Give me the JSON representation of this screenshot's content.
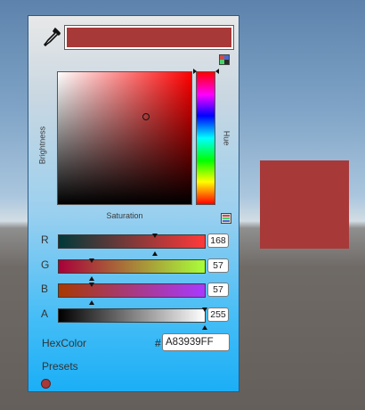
{
  "colors": {
    "current": "#A83939",
    "hue_pure": "#FF0000",
    "red_track_from": "#003939",
    "red_track_to": "#FF3939",
    "green_track_from": "#A80039",
    "green_track_to": "#A8FF39",
    "blue_track_from": "#A83900",
    "blue_track_to": "#A839FF",
    "alpha_track_from": "#000000",
    "alpha_track_to": "#FFFFFF"
  },
  "picker": {
    "brightness_label": "Brightness",
    "saturation_label": "Saturation",
    "hue_label": "Hue",
    "saturation": 0.66,
    "brightness": 0.66,
    "hue": 0.0
  },
  "channels": [
    {
      "label": "R",
      "value": "168"
    },
    {
      "label": "G",
      "value": "57"
    },
    {
      "label": "B",
      "value": "57"
    },
    {
      "label": "A",
      "value": "255"
    }
  ],
  "hex": {
    "label": "HexColor",
    "hash": "#",
    "value": "A83939FF"
  },
  "presets": {
    "label": "Presets",
    "items": [
      "#A83939"
    ]
  },
  "icons": {
    "eyedropper": "eyedropper-icon",
    "color_mode": "color-mode-icon",
    "slider_mode": "slider-mode-icon"
  }
}
